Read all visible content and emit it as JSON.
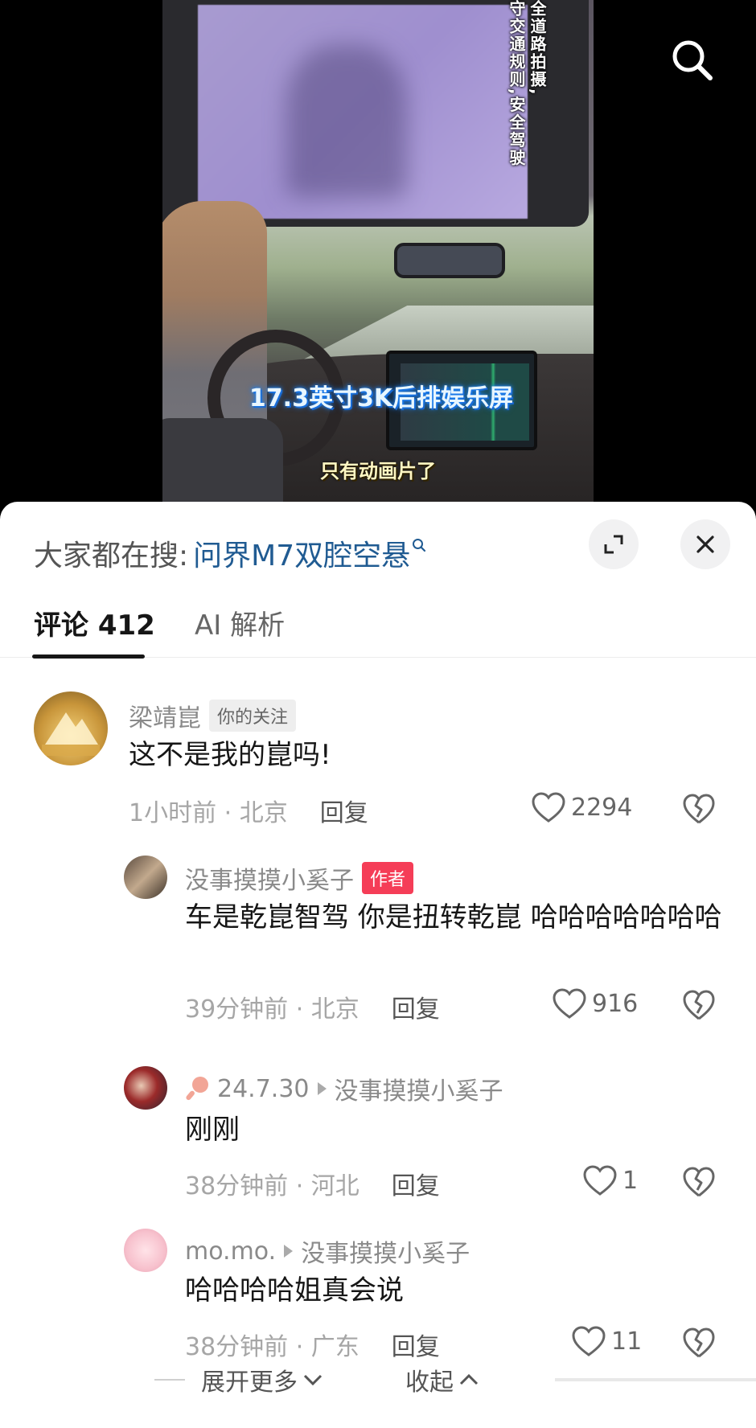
{
  "video": {
    "vertical_caption_col1": "全道路拍摄,",
    "vertical_caption_col2": "守交通规则,安全驾驶",
    "caption_blue": "17.3英寸3K后排娱乐屏",
    "caption_yellow": "只有动画片了"
  },
  "hot_search": {
    "label": "大家都在搜:",
    "term": "问界M7双腔空悬"
  },
  "tabs": [
    {
      "label": "评论 412"
    },
    {
      "label": "AI 解析"
    }
  ],
  "comments": [
    {
      "username": "梁靖崑",
      "tag": "你的关注",
      "text": "这不是我的崑吗!",
      "time_loc": "1小时前 · 北京",
      "reply": "回复",
      "likes": "2294"
    },
    {
      "username": "没事摸摸小奚子",
      "tag": "作者",
      "text": "车是乾崑智驾 你是扭转乾崑 哈哈哈哈哈哈哈",
      "time_loc": "39分钟前 · 北京",
      "reply": "回复",
      "likes": "916"
    },
    {
      "username": "24.7.30",
      "reply_to": "没事摸摸小奚子",
      "text": "刚刚",
      "time_loc": "38分钟前 · 河北",
      "reply": "回复",
      "likes": "1"
    },
    {
      "username": "mo.mo.",
      "reply_to": "没事摸摸小奚子",
      "text": "哈哈哈哈姐真会说",
      "time_loc": "38分钟前 · 广东",
      "reply": "回复",
      "likes": "11"
    }
  ],
  "footer": {
    "expand": "展开更多",
    "collapse": "收起"
  },
  "colors": {
    "hot_term": "#205b92",
    "author_tag": "#f53d57",
    "caption_blue_glow": "#1a7ef0"
  },
  "icons": [
    "search-icon",
    "expand-icon",
    "close-icon",
    "heart-icon",
    "broken-heart-icon",
    "ping-pong-icon",
    "chevron-down-icon",
    "chevron-up-icon"
  ]
}
